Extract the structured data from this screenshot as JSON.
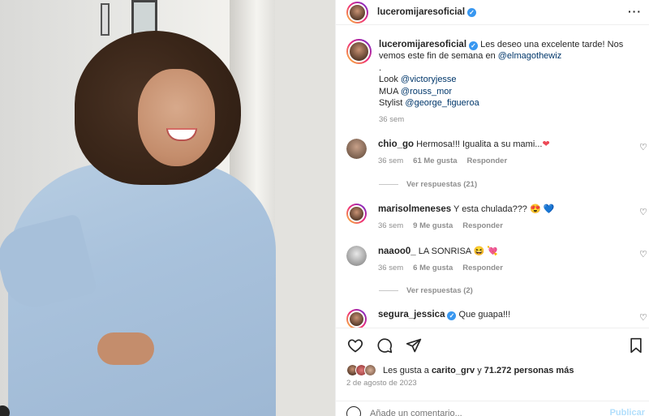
{
  "post": {
    "username": "luceromijaresoficial",
    "caption": {
      "line1": "Les deseo una excelente tarde! Nos vemos este fin de semana en",
      "mention1": "@elmagothewiz",
      "dot": ".",
      "look_label": "Look",
      "look_mention": "@victoryjesse",
      "mua_label": "MUA",
      "mua_mention": "@rouss_mor",
      "stylist_label": "Stylist",
      "stylist_mention": "@george_figueroa",
      "time": "36 sem"
    }
  },
  "comments": [
    {
      "user": "chio_go",
      "text": "Hermosa!!! Igualita a su mami...",
      "emoji": "❤",
      "time": "36 sem",
      "likes": "61 Me gusta",
      "reply": "Responder",
      "view_replies": "Ver respuestas (21)"
    },
    {
      "user": "marisolmeneses",
      "text": "Y esta chulada???",
      "emoji": "😍 💙",
      "time": "36 sem",
      "likes": "9 Me gusta",
      "reply": "Responder"
    },
    {
      "user": "naaoo0_",
      "text": "LA SONRISA",
      "emoji": "😆 💘",
      "time": "36 sem",
      "likes": "6 Me gusta",
      "reply": "Responder",
      "view_replies": "Ver respuestas (2)"
    },
    {
      "user": "segura_jessica",
      "text": "Que guapa!!!",
      "verified": true
    }
  ],
  "actions": {
    "likes_prefix": "Les gusta a",
    "liker": "carito_grv",
    "likes_mid": "y",
    "likes_count": "71.272 personas más",
    "date": "2 de agosto de 2023"
  },
  "composer": {
    "placeholder": "Añade un comentario...",
    "publish": "Publicar"
  },
  "colors": {
    "link": "#00376b",
    "verified": "#3897f0",
    "heart": "#ed4956",
    "muted": "#8e8e8e"
  }
}
